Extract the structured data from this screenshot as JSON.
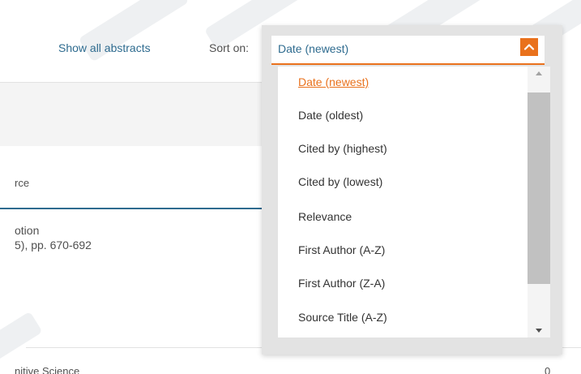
{
  "toolbar": {
    "show_abstracts": "Show all abstracts",
    "sort_label": "Sort on:"
  },
  "results": {
    "column_header": "rce",
    "item": {
      "line1": "otion",
      "line2": "5), pp. 670-692"
    },
    "bottom_row": {
      "text": "nitive Science",
      "count": "0"
    }
  },
  "sort_dropdown": {
    "selected_value": "Date (newest)",
    "options": [
      "Date (newest)",
      "Date (oldest)",
      "Cited by (highest)",
      "Cited by (lowest)",
      "Relevance",
      "First Author (A-Z)",
      "First Author (Z-A)",
      "Source Title (A-Z)"
    ],
    "highlighted_index": 0,
    "scrollbar": {
      "up_icon": "triangle-up-icon",
      "down_icon": "triangle-down-icon"
    },
    "toggle_icon": "chevron-up-icon"
  },
  "colors": {
    "accent": "#e9711c",
    "link": "#2e6b8f",
    "text": "#333333",
    "panel_bg": "#e3e3e3",
    "scroll_thumb": "#c1c1c1"
  }
}
